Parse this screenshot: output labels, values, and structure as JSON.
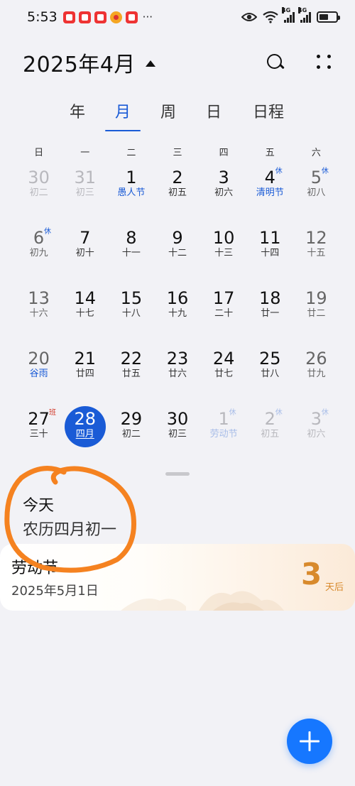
{
  "status_bar": {
    "time": "5:53",
    "more": "···",
    "signal_label_1": "4G",
    "signal_label_2": "4G"
  },
  "header": {
    "title": "2025年4月",
    "caret_icon": "caret-up-icon",
    "search_icon": "search-icon",
    "more_icon": "grid-dots-icon"
  },
  "view_tabs": [
    {
      "label": "年",
      "active": false
    },
    {
      "label": "月",
      "active": true
    },
    {
      "label": "周",
      "active": false
    },
    {
      "label": "日",
      "active": false
    },
    {
      "label": "日程",
      "active": false
    }
  ],
  "weekdays": [
    "日",
    "一",
    "二",
    "三",
    "四",
    "五",
    "六"
  ],
  "days": [
    {
      "num": "30",
      "sub": "初二",
      "other": true,
      "weekend": true
    },
    {
      "num": "31",
      "sub": "初三",
      "other": true
    },
    {
      "num": "1",
      "sub": "愚人节",
      "holiday": true
    },
    {
      "num": "2",
      "sub": "初五"
    },
    {
      "num": "3",
      "sub": "初六"
    },
    {
      "num": "4",
      "sub": "清明节",
      "holiday": true,
      "badge": "休",
      "badge_type": "rest"
    },
    {
      "num": "5",
      "sub": "初八",
      "weekend": true,
      "badge": "休",
      "badge_type": "rest"
    },
    {
      "num": "6",
      "sub": "初九",
      "weekend": true,
      "badge": "休",
      "badge_type": "rest"
    },
    {
      "num": "7",
      "sub": "初十"
    },
    {
      "num": "8",
      "sub": "十一"
    },
    {
      "num": "9",
      "sub": "十二"
    },
    {
      "num": "10",
      "sub": "十三"
    },
    {
      "num": "11",
      "sub": "十四"
    },
    {
      "num": "12",
      "sub": "十五",
      "weekend": true
    },
    {
      "num": "13",
      "sub": "十六",
      "weekend": true
    },
    {
      "num": "14",
      "sub": "十七"
    },
    {
      "num": "15",
      "sub": "十八"
    },
    {
      "num": "16",
      "sub": "十九"
    },
    {
      "num": "17",
      "sub": "二十"
    },
    {
      "num": "18",
      "sub": "廿一"
    },
    {
      "num": "19",
      "sub": "廿二",
      "weekend": true
    },
    {
      "num": "20",
      "sub": "谷雨",
      "holiday": true,
      "weekend": true
    },
    {
      "num": "21",
      "sub": "廿四"
    },
    {
      "num": "22",
      "sub": "廿五"
    },
    {
      "num": "23",
      "sub": "廿六"
    },
    {
      "num": "24",
      "sub": "廿七"
    },
    {
      "num": "25",
      "sub": "廿八"
    },
    {
      "num": "26",
      "sub": "廿九",
      "weekend": true
    },
    {
      "num": "27",
      "sub": "三十",
      "badge": "班",
      "badge_type": "work"
    },
    {
      "num": "28",
      "sub": "四月",
      "today": true
    },
    {
      "num": "29",
      "sub": "初二"
    },
    {
      "num": "30",
      "sub": "初三"
    },
    {
      "num": "1",
      "sub": "劳动节",
      "holiday": true,
      "other": true,
      "badge": "休",
      "badge_type": "rest"
    },
    {
      "num": "2",
      "sub": "初五",
      "other": true,
      "badge": "休",
      "badge_type": "rest"
    },
    {
      "num": "3",
      "sub": "初六",
      "other": true,
      "weekend": true,
      "badge": "休",
      "badge_type": "rest"
    }
  ],
  "today_panel": {
    "today_label": "今天",
    "lunar_label": "农历四月初一"
  },
  "holiday_card": {
    "name": "劳动节",
    "date": "2025年5月1日",
    "countdown": "3",
    "unit": "天后"
  },
  "fab": {
    "icon": "plus-icon"
  },
  "colors": {
    "accent": "#1a5bd6",
    "fab": "#1677ff",
    "work_badge": "#d23a2a",
    "countdown": "#d88a2c",
    "annotation": "#f58220",
    "background": "#f2f2f6"
  }
}
